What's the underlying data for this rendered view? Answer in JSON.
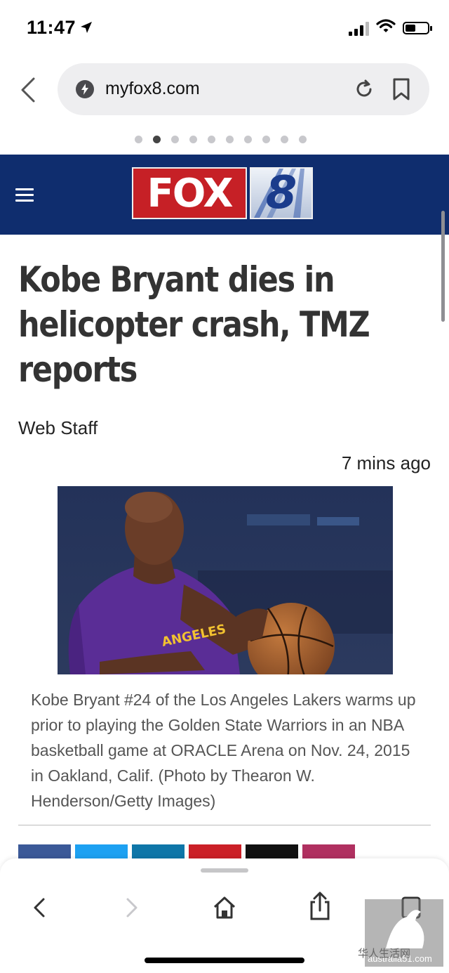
{
  "status_bar": {
    "time": "11:47"
  },
  "browser": {
    "url": "myfox8.com",
    "page_dots": 10,
    "active_dot": 1
  },
  "site": {
    "logo_left": "FOX",
    "logo_right": "8"
  },
  "article": {
    "headline": "Kobe Bryant dies in helicopter crash, TMZ reports",
    "byline": "Web Staff",
    "timestamp": "7 mins ago",
    "photo_jersey_text": "ANGELES",
    "caption": "Kobe Bryant #24 of the Los Angeles Lakers warms up prior to playing the Golden State Warriors in an NBA basketball game at ORACLE Arena on Nov. 24, 2015 in Oakland, Calif. (Photo by Thearon W. Henderson/Getty Images)"
  },
  "watermark": {
    "cn": "华人生活网",
    "site": "australia51.com"
  },
  "colors": {
    "header_bg": "#0f2d6e",
    "fox_red": "#c62026",
    "jersey_purple": "#5a2d96"
  }
}
